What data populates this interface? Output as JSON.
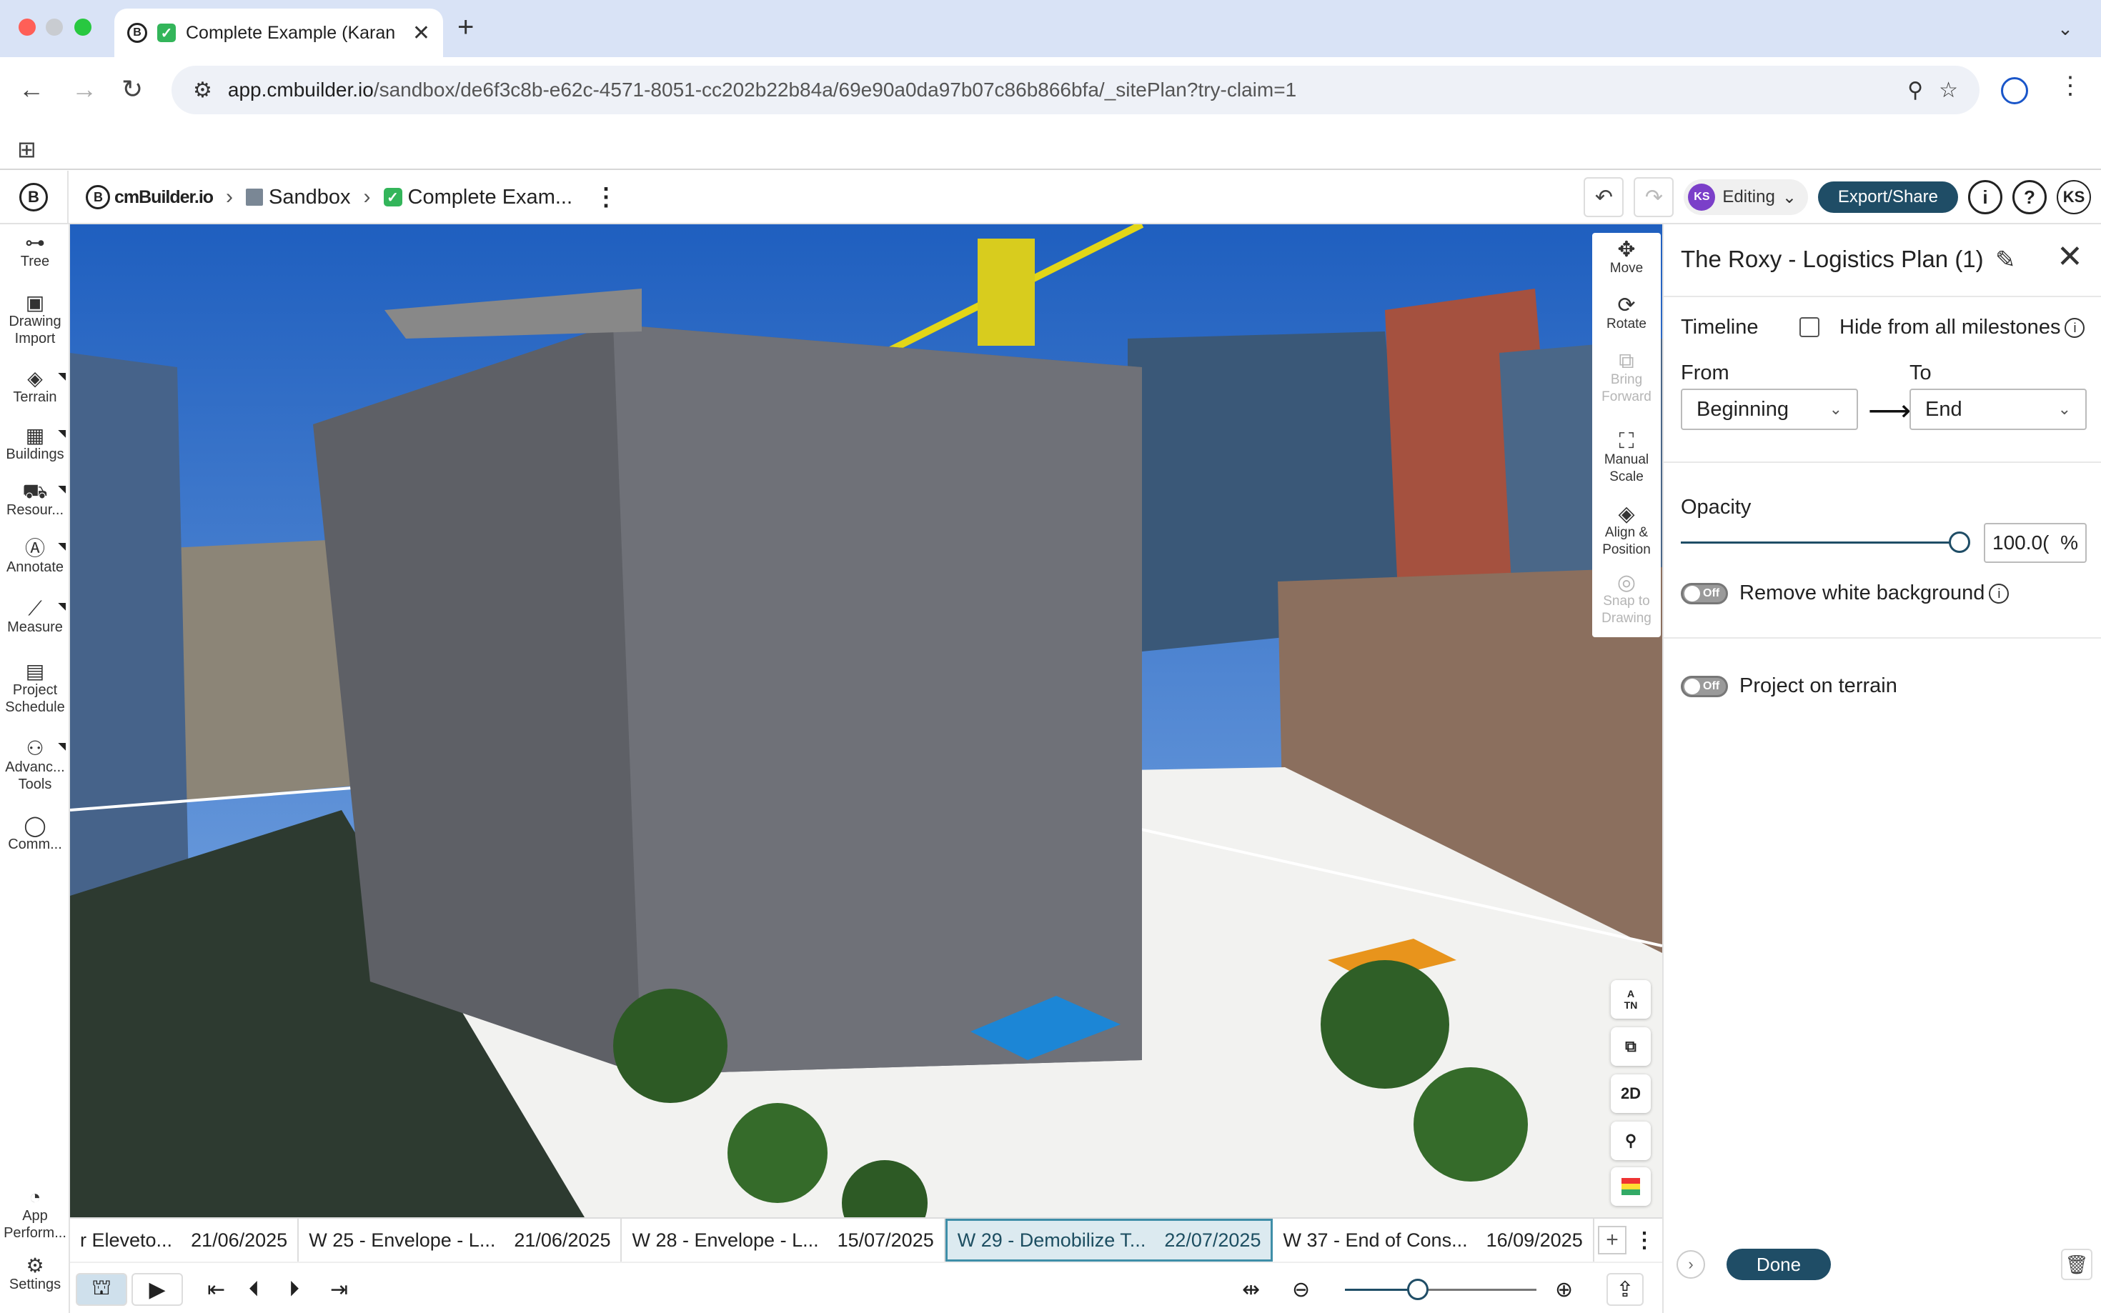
{
  "browser": {
    "tab_title": "Complete Example (Karan",
    "tab_close": "✕",
    "new_tab": "+",
    "url_host": "app.cmbuilder.io",
    "url_path": "/sandbox/de6f3c8b-e62c-4571-8051-cc202b22b84a/69e90a0da97b07c86b866bfa/_sitePlan?try-claim=1"
  },
  "header": {
    "brand": "cmBuilder.io",
    "crumb_sandbox": "Sandbox",
    "crumb_project": "Complete Exam...",
    "editing_initials": "KS",
    "editing_label": "Editing",
    "export_label": "Export/Share",
    "info_label": "i",
    "help_label": "?",
    "user_initials": "KS"
  },
  "sidebar": {
    "items": [
      {
        "label": "Tree"
      },
      {
        "label": "Drawing\nImport"
      },
      {
        "label": "Terrain"
      },
      {
        "label": "Buildings"
      },
      {
        "label": "Resour..."
      },
      {
        "label": "Annotate"
      },
      {
        "label": "Measure"
      },
      {
        "label": "Project\nSchedule"
      },
      {
        "label": "Advanc...\nTools"
      },
      {
        "label": "Comm..."
      }
    ],
    "bottom": [
      {
        "label": "App\nPerform..."
      },
      {
        "label": "Settings"
      }
    ]
  },
  "viewport_tools": [
    {
      "label": "Move",
      "icon": "move-icon"
    },
    {
      "label": "Rotate",
      "icon": "rotate-icon"
    },
    {
      "label": "Bring\nForward",
      "icon": "bring-forward-icon"
    },
    {
      "label": "Manual\nScale",
      "icon": "manual-scale-icon"
    },
    {
      "label": "Align &\nPosition",
      "icon": "align-position-icon"
    },
    {
      "label": "Snap to\nDrawing",
      "icon": "snap-icon"
    }
  ],
  "map_controls": {
    "north_label": "TN",
    "twod_label": "2D"
  },
  "timeline": {
    "milestones": [
      {
        "name": "r Eleveto...",
        "date": "21/06/2025"
      },
      {
        "name": "W 25 - Envelope - L...",
        "date": "21/06/2025"
      },
      {
        "name": "W 28 - Envelope - L...",
        "date": "15/07/2025"
      },
      {
        "name": "W 29 - Demobilize T...",
        "date": "22/07/2025"
      },
      {
        "name": "W 37 - End of Cons...",
        "date": "16/09/2025"
      }
    ],
    "add_label": "+",
    "zoom_level": 0.38
  },
  "panel": {
    "title": "The Roxy - Logistics Plan (1)",
    "timeline_label": "Timeline",
    "hide_label": "Hide from all milestones",
    "from_label": "From",
    "to_label": "To",
    "from_value": "Beginning",
    "to_value": "End",
    "opacity_label": "Opacity",
    "opacity_value": "100.0(",
    "opacity_unit": "%",
    "opacity_level": 1.0,
    "remove_bg_label": "Remove white background",
    "project_terrain_label": "Project on terrain",
    "toggle_off": "Off",
    "done_label": "Done"
  },
  "colors": {
    "accent": "#1f4d66",
    "active_milestone": "#dceaf0",
    "avatar": "#7b3fc9"
  }
}
